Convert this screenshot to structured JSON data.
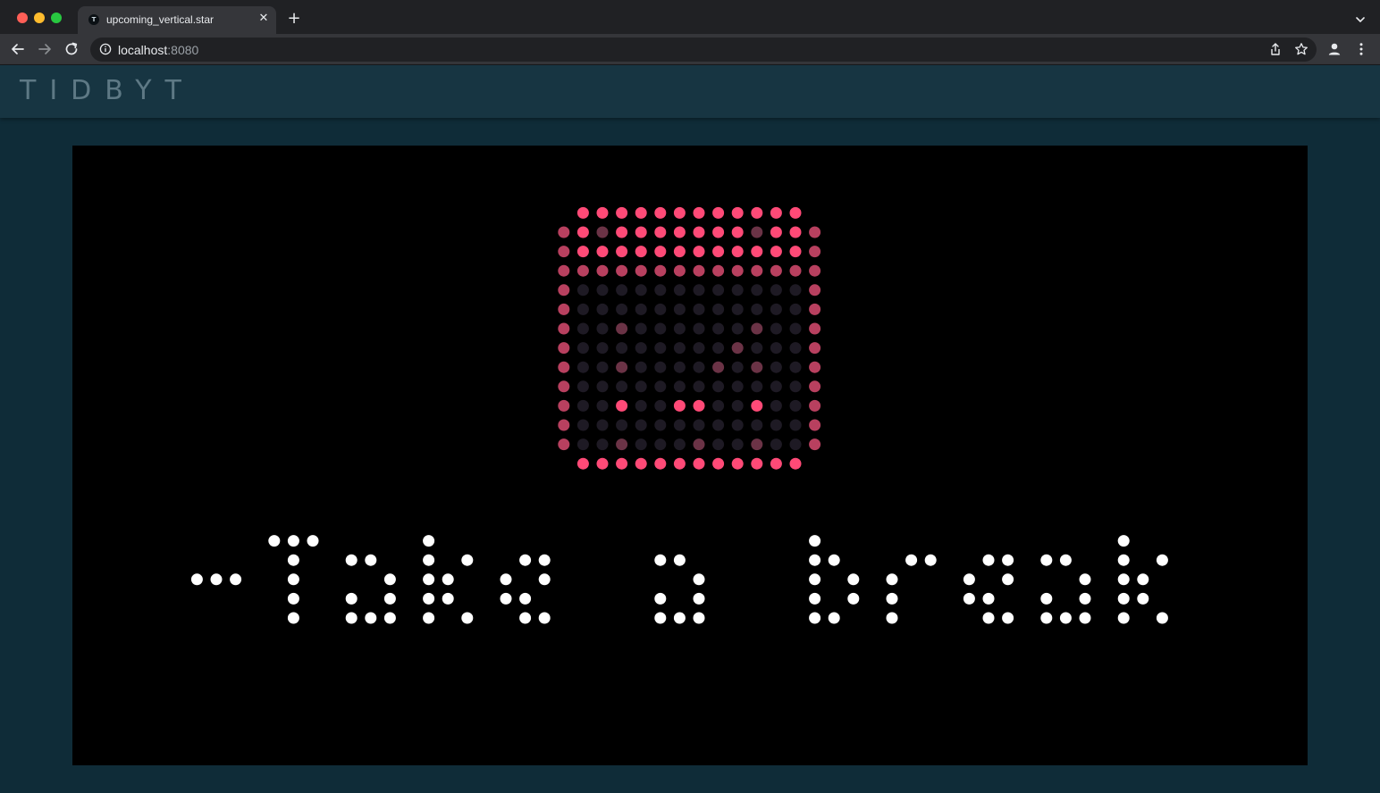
{
  "browser": {
    "tab_title": "upcoming_vertical.star",
    "tab_favicon": "T",
    "url_host": "localhost",
    "url_port": ":8080",
    "icons": {
      "back": "arrow-left-icon",
      "forward": "arrow-right-icon",
      "reload": "reload-icon",
      "info": "info-icon",
      "share": "share-icon",
      "bookmark": "star-icon",
      "profile": "profile-icon",
      "menu": "kebab-menu-icon",
      "close_tab": "close-icon",
      "new_tab": "plus-icon",
      "tab_search": "chevron-down-icon"
    }
  },
  "page": {
    "logo": "TIDBYT"
  },
  "display": {
    "matrix": "64x32 LED pixels",
    "calendar_icon": {
      "frame_color": "#ff4a77",
      "frame_dim_color": "#b8405f",
      "cell_color": "#1e1a24"
    },
    "message": "-Take a break",
    "message_color": "#ffffff"
  }
}
